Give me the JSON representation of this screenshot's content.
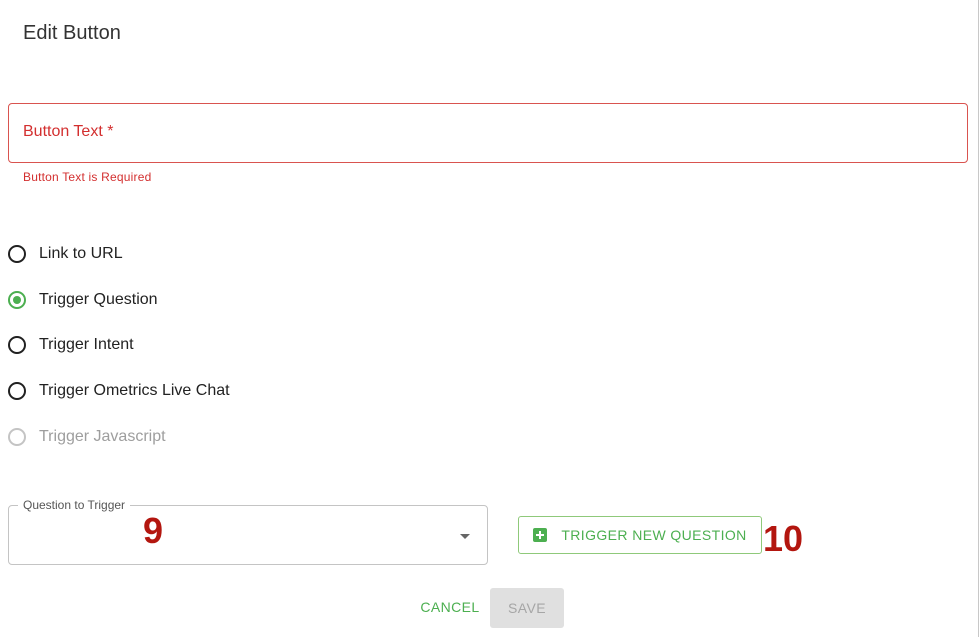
{
  "dialog": {
    "title": "Edit Button"
  },
  "button_text_field": {
    "label": "Button Text *",
    "value": "",
    "error": "Button Text is Required"
  },
  "action_options": [
    {
      "label": "Link to URL",
      "state": "unchecked"
    },
    {
      "label": "Trigger Question",
      "state": "checked"
    },
    {
      "label": "Trigger Intent",
      "state": "unchecked"
    },
    {
      "label": "Trigger Ometrics Live Chat",
      "state": "unchecked"
    },
    {
      "label": "Trigger Javascript",
      "state": "disabled"
    }
  ],
  "question_select": {
    "label": "Question to Trigger",
    "value": "",
    "icon": "dropdown-arrow-icon"
  },
  "annotations": {
    "marker_9": "9",
    "marker_10": "10"
  },
  "trigger_new_question": {
    "label": "TRIGGER NEW QUESTION",
    "icon": "add-box-icon"
  },
  "footer": {
    "cancel_label": "CANCEL",
    "save_label": "SAVE"
  },
  "colors": {
    "accent": "#4caf50",
    "error": "#d32f2f",
    "annotation": "#b3160f",
    "disabled": "#e0e0e0"
  }
}
